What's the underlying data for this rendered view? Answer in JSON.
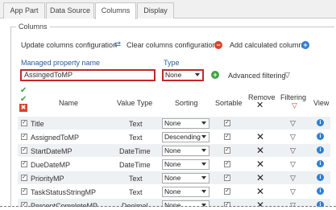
{
  "tabs": [
    "App Part",
    "Data Source",
    "Columns",
    "Display"
  ],
  "legend": "Columns",
  "toolbar": {
    "update_label": "Update columns configuration",
    "clear_label": "Clear columns configuration",
    "add_label": "Add calculated column"
  },
  "form": {
    "property_label": "Managed property name",
    "property_value": "AssingedToMP",
    "type_label": "Type",
    "type_value": "None",
    "advanced_label": "Advanced filtering"
  },
  "headers": {
    "name": "Name",
    "value_type": "Value Type",
    "sorting": "Sorting",
    "sortable": "Sortable",
    "remove": "Remove",
    "filtering": "Filtering",
    "view": "View"
  },
  "rows": [
    {
      "name": "Title",
      "type": "Text",
      "sorting": "None"
    },
    {
      "name": "AssignedToMP",
      "type": "Text",
      "sorting": "Descending"
    },
    {
      "name": "StartDateMP",
      "type": "DateTime",
      "sorting": "None"
    },
    {
      "name": "DueDateMP",
      "type": "DateTime",
      "sorting": "None"
    },
    {
      "name": "PriorityMP",
      "type": "Text",
      "sorting": "None"
    },
    {
      "name": "TaskStatusStringMP",
      "type": "Text",
      "sorting": "None"
    },
    {
      "name": "PercentCompleteMP",
      "type": "Decimal",
      "sorting": "None"
    }
  ],
  "icons": {
    "refresh": "refresh-icon",
    "clear": "minus-circle-icon",
    "add": "plus-circle-icon",
    "filter": "funnel-icon",
    "info": "info-icon"
  },
  "colors": {
    "highlight": "#c0282a",
    "accent_blue": "#2f7fd0",
    "green": "#43a047",
    "red": "#d9452b"
  }
}
